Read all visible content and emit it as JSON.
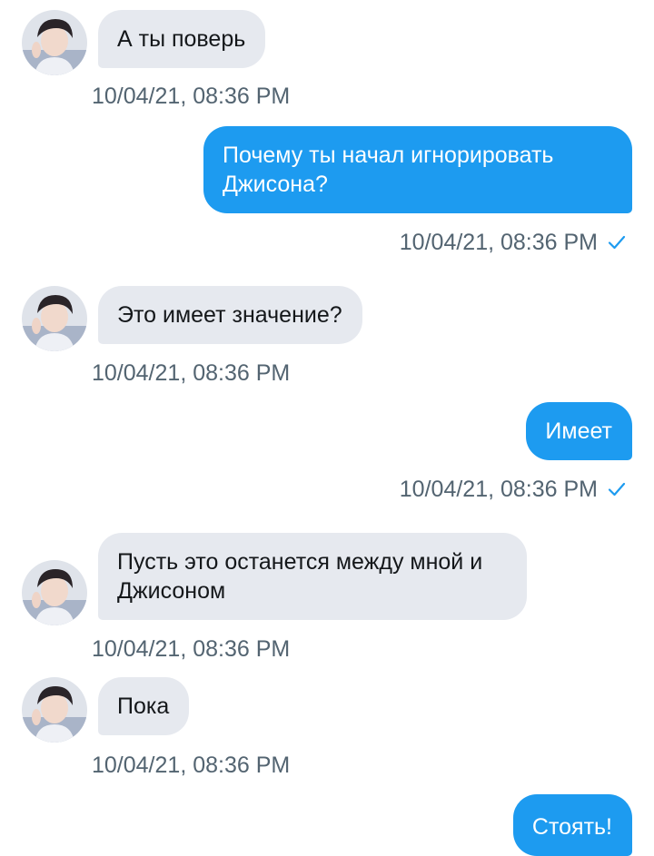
{
  "conversation": {
    "messages": [
      {
        "direction": "in",
        "text": "А ты поверь",
        "timestamp": "10/04/21, 08:36 PM"
      },
      {
        "direction": "out",
        "text": "Почему ты начал игнорировать Джисона?",
        "timestamp": "10/04/21, 08:36 PM",
        "read_icon": "checkmark-icon"
      },
      {
        "direction": "in",
        "text": "Это имеет значение?",
        "timestamp": "10/04/21, 08:36 PM"
      },
      {
        "direction": "out",
        "text": "Имеет",
        "timestamp": "10/04/21, 08:36 PM",
        "read_icon": "checkmark-icon"
      },
      {
        "direction": "in",
        "text": "Пусть это останется между мной и Джисоном",
        "timestamp": "10/04/21, 08:36 PM"
      },
      {
        "direction": "in",
        "text": "Пока",
        "timestamp": "10/04/21, 08:36 PM"
      },
      {
        "direction": "out",
        "text": "Стоять!"
      }
    ]
  },
  "colors": {
    "outgoing_bubble": "#1d9bf0",
    "incoming_bubble": "#e6e9ef",
    "timestamp_text": "#536471",
    "checkmark": "#1d9bf0"
  }
}
